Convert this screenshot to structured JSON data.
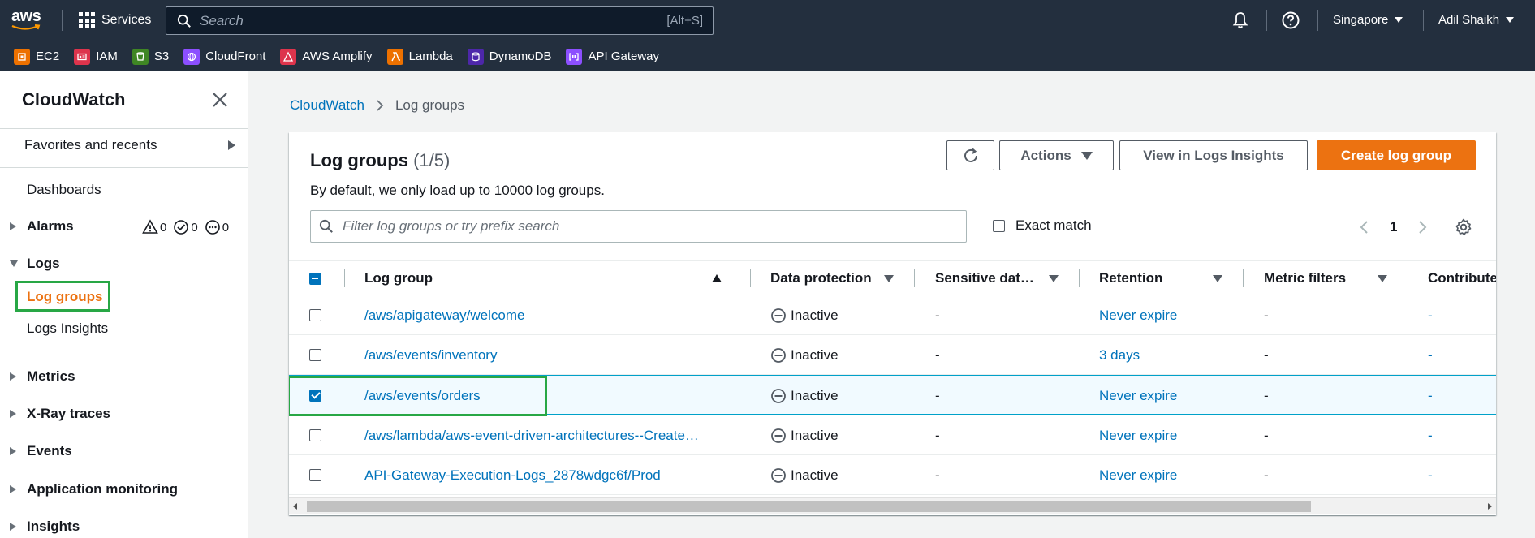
{
  "topnav": {
    "logo": "aws",
    "services_label": "Services",
    "search_placeholder": "Search",
    "search_shortcut": "[Alt+S]",
    "region": "Singapore",
    "user": "Adil Shaikh"
  },
  "favorites": [
    {
      "label": "EC2",
      "color": "#ed7100",
      "icon": "ec2-icon"
    },
    {
      "label": "IAM",
      "color": "#dd344c",
      "icon": "iam-icon"
    },
    {
      "label": "S3",
      "color": "#3f8624",
      "icon": "s3-icon"
    },
    {
      "label": "CloudFront",
      "color": "#8c4fff",
      "icon": "cloudfront-icon"
    },
    {
      "label": "AWS Amplify",
      "color": "#dd344c",
      "icon": "amplify-icon"
    },
    {
      "label": "Lambda",
      "color": "#ed7100",
      "icon": "lambda-icon"
    },
    {
      "label": "DynamoDB",
      "color": "#4d27aa",
      "icon": "dynamodb-icon"
    },
    {
      "label": "API Gateway",
      "color": "#8c4fff",
      "icon": "api-gateway-icon"
    }
  ],
  "sidebar": {
    "title": "CloudWatch",
    "favorites_label": "Favorites and recents",
    "dashboards": "Dashboards",
    "alarms": "Alarms",
    "alarm_counts": {
      "in_alarm": "0",
      "ok": "0",
      "insufficient": "0"
    },
    "logs": "Logs",
    "log_groups": "Log groups",
    "logs_insights": "Logs Insights",
    "metrics": "Metrics",
    "xray": "X-Ray traces",
    "events": "Events",
    "app_monitoring": "Application monitoring",
    "insights": "Insights"
  },
  "breadcrumb": {
    "root": "CloudWatch",
    "current": "Log groups"
  },
  "panel": {
    "title": "Log groups",
    "count": "(1/5)",
    "description": "By default, we only load up to 10000 log groups.",
    "actions_label": "Actions",
    "view_insights_label": "View in Logs Insights",
    "create_label": "Create log group",
    "filter_placeholder": "Filter log groups or try prefix search",
    "exact_match_label": "Exact match",
    "page": "1"
  },
  "table": {
    "columns": [
      "Log group",
      "Data protection",
      "Sensitive dat…",
      "Retention",
      "Metric filters",
      "Contribute"
    ],
    "rows": [
      {
        "name": "/aws/apigateway/welcome",
        "protection": "Inactive",
        "sensitive": "-",
        "retention": "Never expire",
        "metric": "-",
        "contrib": "-",
        "selected": false
      },
      {
        "name": "/aws/events/inventory",
        "protection": "Inactive",
        "sensitive": "-",
        "retention": "3 days",
        "metric": "-",
        "contrib": "-",
        "selected": false
      },
      {
        "name": "/aws/events/orders",
        "protection": "Inactive",
        "sensitive": "-",
        "retention": "Never expire",
        "metric": "-",
        "contrib": "-",
        "selected": true
      },
      {
        "name": "/aws/lambda/aws-event-driven-architectures--Create…",
        "protection": "Inactive",
        "sensitive": "-",
        "retention": "Never expire",
        "metric": "-",
        "contrib": "-",
        "selected": false
      },
      {
        "name": "API-Gateway-Execution-Logs_2878wdgc6f/Prod",
        "protection": "Inactive",
        "sensitive": "-",
        "retention": "Never expire",
        "metric": "-",
        "contrib": "-",
        "selected": false
      }
    ]
  },
  "colors": {
    "nav_bg": "#232f3e",
    "link": "#0073bb",
    "primary": "#ec7211",
    "highlight": "#28a745"
  }
}
